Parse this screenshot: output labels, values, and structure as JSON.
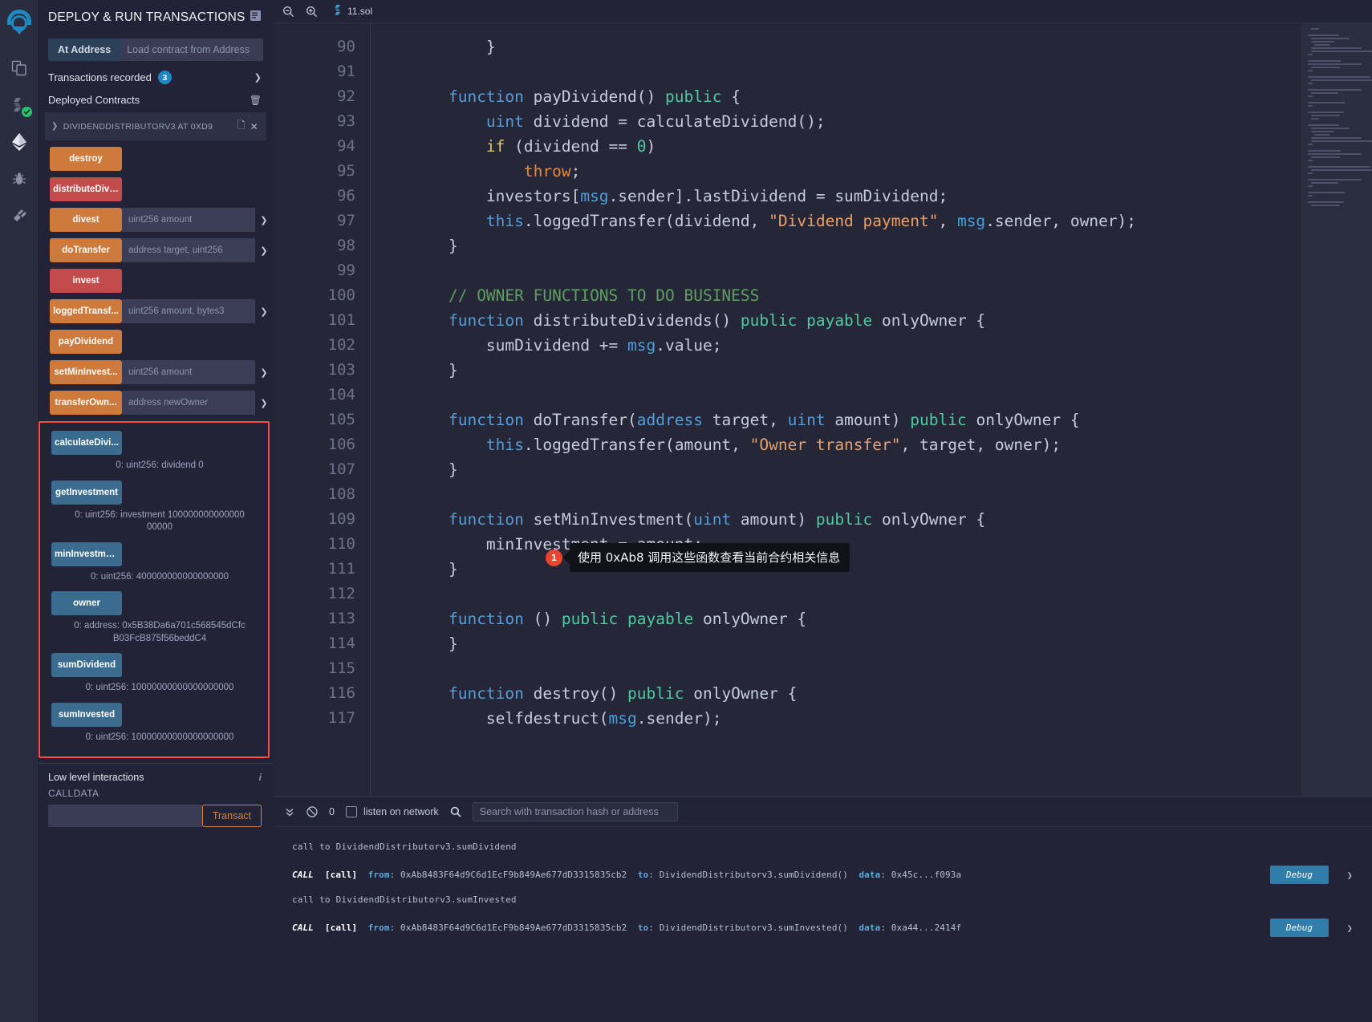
{
  "rail": {
    "items": [
      {
        "name": "remix-logo",
        "label": "Remix"
      },
      {
        "name": "file-explorer-icon",
        "label": "File explorers"
      },
      {
        "name": "solidity-compiler-icon",
        "label": "Solidity compiler"
      },
      {
        "name": "deploy-run-icon",
        "label": "Deploy & run transactions"
      },
      {
        "name": "debugger-icon",
        "label": "Debugger"
      },
      {
        "name": "plugin-manager-icon",
        "label": "Plugin manager"
      }
    ]
  },
  "sidebar": {
    "title": "DEPLOY & RUN TRANSACTIONS",
    "header_icon": "book-icon",
    "at_address": {
      "button_label": "At Address",
      "input_placeholder": "Load contract from Address",
      "input_value": ""
    },
    "transactions_recorded": {
      "label": "Transactions recorded",
      "count": "3",
      "caret": "chevron-down-icon"
    },
    "deployed_contracts": {
      "label": "Deployed Contracts",
      "trash_icon": "trash-icon"
    },
    "contract": {
      "caret": "chevron-down-icon",
      "name": "DIVIDENDDISTRIBUTORV3 AT 0XD9",
      "copy_icon": "copy-icon",
      "close_icon": "close-icon"
    },
    "functions": [
      {
        "label": "destroy",
        "color": "orange",
        "placeholder": "",
        "has_input": false,
        "has_caret": false
      },
      {
        "label": "distributeDivi...",
        "color": "red",
        "placeholder": "",
        "has_input": false,
        "has_caret": false
      },
      {
        "label": "divest",
        "color": "orange",
        "placeholder": "uint256 amount",
        "has_input": true,
        "has_caret": true
      },
      {
        "label": "doTransfer",
        "color": "orange",
        "placeholder": "address target, uint256",
        "has_input": true,
        "has_caret": true
      },
      {
        "label": "invest",
        "color": "red",
        "placeholder": "",
        "has_input": false,
        "has_caret": false
      },
      {
        "label": "loggedTransf...",
        "color": "orange",
        "placeholder": "uint256 amount, bytes3",
        "has_input": true,
        "has_caret": true
      },
      {
        "label": "payDividend",
        "color": "orange",
        "placeholder": "",
        "has_input": false,
        "has_caret": false
      },
      {
        "label": "setMinInvest...",
        "color": "orange",
        "placeholder": "uint256 amount",
        "has_input": true,
        "has_caret": true
      },
      {
        "label": "transferOwn...",
        "color": "orange",
        "placeholder": "address newOwner",
        "has_input": true,
        "has_caret": true
      }
    ],
    "highlight_color": "#fa4b4b",
    "view_functions": [
      {
        "label": "calculateDivi...",
        "result": "0: uint256: dividend 0"
      },
      {
        "label": "getInvestment",
        "result": "0:  uint256: investment 10000000000000000000"
      },
      {
        "label": "minInvestment",
        "result": "0: uint256: 400000000000000000"
      },
      {
        "label": "owner",
        "result": "0:  address: 0x5B38Da6a701c568545dCfcB03FcB875f56beddC4"
      },
      {
        "label": "sumDividend",
        "result": "0: uint256: 10000000000000000000"
      },
      {
        "label": "sumInvested",
        "result": "0: uint256: 10000000000000000000"
      }
    ],
    "low_level": {
      "title": "Low level interactions",
      "info_icon": "info-icon",
      "calldata_label": "CALLDATA",
      "calldata_value": "",
      "transact_label": "Transact"
    }
  },
  "editor": {
    "zoom_out_icon": "zoom-out-icon",
    "zoom_in_icon": "zoom-in-icon",
    "tab_icon": "solidity-icon",
    "tab_label": "11.sol",
    "first_line_number": 90,
    "lines": [
      {
        "n": 90,
        "tokens": [
          {
            "t": "        }",
            "c": "k-pl"
          }
        ]
      },
      {
        "n": 91,
        "tokens": []
      },
      {
        "n": 92,
        "tokens": [
          {
            "t": "    ",
            "c": "k-pl"
          },
          {
            "t": "function",
            "c": "k-fn"
          },
          {
            "t": " payDividend() ",
            "c": "k-pl"
          },
          {
            "t": "public",
            "c": "k-mod"
          },
          {
            "t": " {",
            "c": "k-pl"
          }
        ]
      },
      {
        "n": 93,
        "tokens": [
          {
            "t": "        ",
            "c": "k-pl"
          },
          {
            "t": "uint",
            "c": "k-typ"
          },
          {
            "t": " dividend = calculateDividend();",
            "c": "k-pl"
          }
        ]
      },
      {
        "n": 94,
        "tokens": [
          {
            "t": "        ",
            "c": "k-pl"
          },
          {
            "t": "if",
            "c": "k-ctl"
          },
          {
            "t": " (dividend == ",
            "c": "k-pl"
          },
          {
            "t": "0",
            "c": "k-num"
          },
          {
            "t": ")",
            "c": "k-pl"
          }
        ]
      },
      {
        "n": 95,
        "tokens": [
          {
            "t": "            ",
            "c": "k-pl"
          },
          {
            "t": "throw",
            "c": "k-thr"
          },
          {
            "t": ";",
            "c": "k-pl"
          }
        ]
      },
      {
        "n": 96,
        "tokens": [
          {
            "t": "        investors[",
            "c": "k-pl"
          },
          {
            "t": "msg",
            "c": "k-msg"
          },
          {
            "t": ".sender].lastDividend = sumDividend;",
            "c": "k-pl"
          }
        ]
      },
      {
        "n": 97,
        "tokens": [
          {
            "t": "        ",
            "c": "k-pl"
          },
          {
            "t": "this",
            "c": "k-this"
          },
          {
            "t": ".loggedTransfer(dividend, ",
            "c": "k-pl"
          },
          {
            "t": "\"Dividend payment\"",
            "c": "k-str"
          },
          {
            "t": ", ",
            "c": "k-pl"
          },
          {
            "t": "msg",
            "c": "k-msg"
          },
          {
            "t": ".sender, owner);",
            "c": "k-pl"
          }
        ]
      },
      {
        "n": 98,
        "tokens": [
          {
            "t": "    }",
            "c": "k-pl"
          }
        ]
      },
      {
        "n": 99,
        "tokens": []
      },
      {
        "n": 100,
        "tokens": [
          {
            "t": "    ",
            "c": "k-pl"
          },
          {
            "t": "// OWNER FUNCTIONS TO DO BUSINESS",
            "c": "k-com"
          }
        ]
      },
      {
        "n": 101,
        "tokens": [
          {
            "t": "    ",
            "c": "k-pl"
          },
          {
            "t": "function",
            "c": "k-fn"
          },
          {
            "t": " distributeDividends() ",
            "c": "k-pl"
          },
          {
            "t": "public payable",
            "c": "k-mod"
          },
          {
            "t": " onlyOwner {",
            "c": "k-pl"
          }
        ]
      },
      {
        "n": 102,
        "tokens": [
          {
            "t": "        sumDividend += ",
            "c": "k-pl"
          },
          {
            "t": "msg",
            "c": "k-msg"
          },
          {
            "t": ".value;",
            "c": "k-pl"
          }
        ]
      },
      {
        "n": 103,
        "tokens": [
          {
            "t": "    }",
            "c": "k-pl"
          }
        ]
      },
      {
        "n": 104,
        "tokens": []
      },
      {
        "n": 105,
        "tokens": [
          {
            "t": "    ",
            "c": "k-pl"
          },
          {
            "t": "function",
            "c": "k-fn"
          },
          {
            "t": " doTransfer(",
            "c": "k-pl"
          },
          {
            "t": "address",
            "c": "k-typ"
          },
          {
            "t": " target, ",
            "c": "k-pl"
          },
          {
            "t": "uint",
            "c": "k-typ"
          },
          {
            "t": " amount) ",
            "c": "k-pl"
          },
          {
            "t": "public",
            "c": "k-mod"
          },
          {
            "t": " onlyOwner {",
            "c": "k-pl"
          }
        ]
      },
      {
        "n": 106,
        "tokens": [
          {
            "t": "        ",
            "c": "k-pl"
          },
          {
            "t": "this",
            "c": "k-this"
          },
          {
            "t": ".loggedTransfer(amount, ",
            "c": "k-pl"
          },
          {
            "t": "\"Owner transfer\"",
            "c": "k-str"
          },
          {
            "t": ", target, owner);",
            "c": "k-pl"
          }
        ]
      },
      {
        "n": 107,
        "tokens": [
          {
            "t": "    }",
            "c": "k-pl"
          }
        ]
      },
      {
        "n": 108,
        "tokens": []
      },
      {
        "n": 109,
        "tokens": [
          {
            "t": "    ",
            "c": "k-pl"
          },
          {
            "t": "function",
            "c": "k-fn"
          },
          {
            "t": " setMinInvestment(",
            "c": "k-pl"
          },
          {
            "t": "uint",
            "c": "k-typ"
          },
          {
            "t": " amount) ",
            "c": "k-pl"
          },
          {
            "t": "public",
            "c": "k-mod"
          },
          {
            "t": " onlyOwner {",
            "c": "k-pl"
          }
        ]
      },
      {
        "n": 110,
        "tokens": [
          {
            "t": "        minInvestment = amount;",
            "c": "k-pl"
          }
        ]
      },
      {
        "n": 111,
        "tokens": [
          {
            "t": "    }",
            "c": "k-pl"
          }
        ]
      },
      {
        "n": 112,
        "tokens": []
      },
      {
        "n": 113,
        "tokens": [
          {
            "t": "    ",
            "c": "k-pl"
          },
          {
            "t": "function",
            "c": "k-fn"
          },
          {
            "t": " () ",
            "c": "k-pl"
          },
          {
            "t": "public payable",
            "c": "k-mod"
          },
          {
            "t": " onlyOwner {",
            "c": "k-pl"
          }
        ]
      },
      {
        "n": 114,
        "tokens": [
          {
            "t": "    }",
            "c": "k-pl"
          }
        ]
      },
      {
        "n": 115,
        "tokens": []
      },
      {
        "n": 116,
        "tokens": [
          {
            "t": "    ",
            "c": "k-pl"
          },
          {
            "t": "function",
            "c": "k-fn"
          },
          {
            "t": " destroy() ",
            "c": "k-pl"
          },
          {
            "t": "public",
            "c": "k-mod"
          },
          {
            "t": " onlyOwner {",
            "c": "k-pl"
          }
        ]
      },
      {
        "n": 117,
        "tokens": [
          {
            "t": "        selfdestruct(",
            "c": "k-pl"
          },
          {
            "t": "msg",
            "c": "k-msg"
          },
          {
            "t": ".sender);",
            "c": "k-pl"
          }
        ]
      }
    ]
  },
  "callout": {
    "number": "1",
    "text": "使用 0xAb8 调用这些函数查看当前合约相关信息"
  },
  "terminal": {
    "collapse_icon": "double-chevron-down-icon",
    "clear_icon": "no-entry-icon",
    "pending_count": "0",
    "listen_label": "listen on network",
    "listen_checked": false,
    "search_icon": "search-icon",
    "search_placeholder": "Search with transaction hash or address",
    "search_value": "",
    "entries": [
      {
        "note": "call to DividendDistributorv3.sumDividend",
        "type": "CALL",
        "tag": "[call]",
        "from_label": "from",
        "from": "0xAb8483F64d9C6d1EcF9b849Ae677dD3315835cb2",
        "to_label": "to",
        "to": "DividendDistributorv3.sumDividend()",
        "data_label": "data",
        "data": "0x45c...f093a",
        "debug_label": "Debug",
        "caret": "chevron-down-icon"
      },
      {
        "note": "call to DividendDistributorv3.sumInvested",
        "type": "CALL",
        "tag": "[call]",
        "from_label": "from",
        "from": "0xAb8483F64d9C6d1EcF9b849Ae677dD3315835cb2",
        "to_label": "to",
        "to": "DividendDistributorv3.sumInvested()",
        "data_label": "data",
        "data": "0xa44...2414f",
        "debug_label": "Debug",
        "caret": "chevron-down-icon"
      }
    ]
  }
}
